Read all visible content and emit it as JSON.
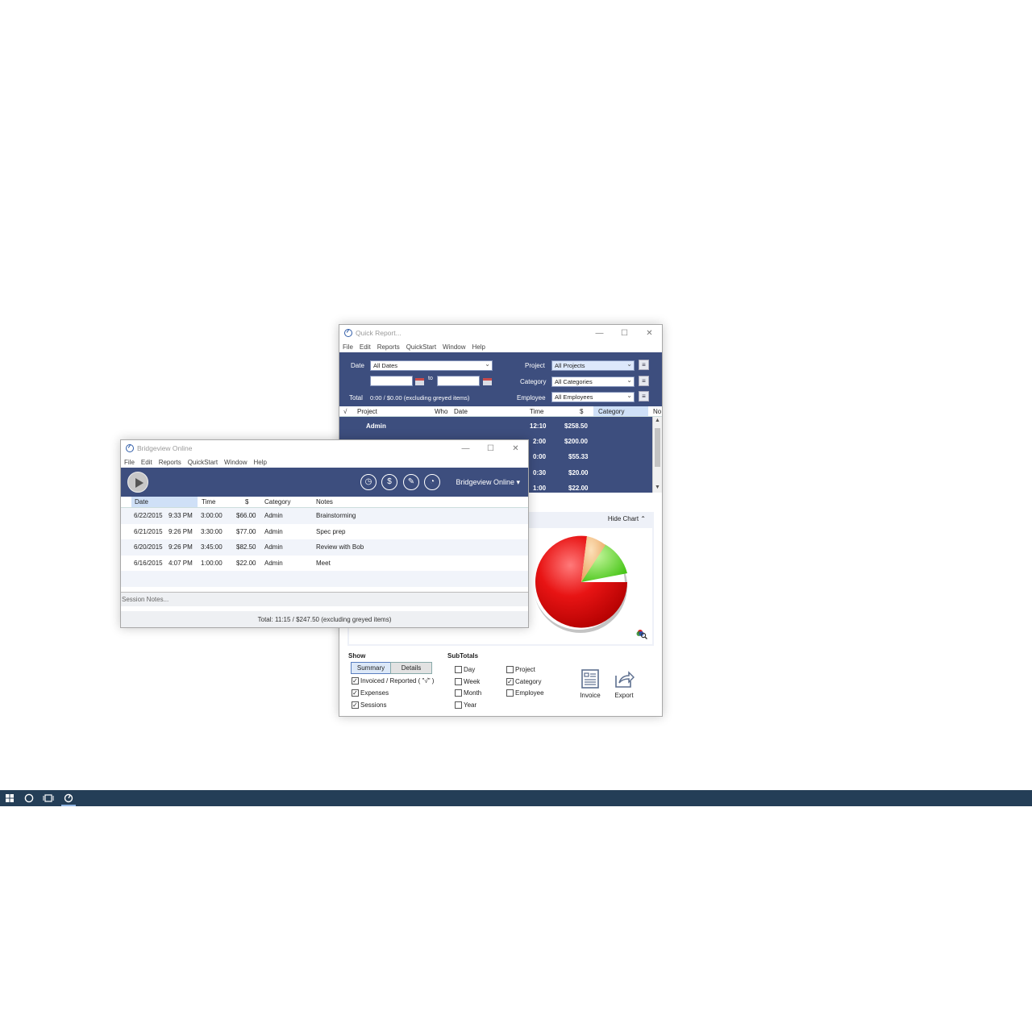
{
  "quick_report": {
    "title": "Quick Report...",
    "menu": [
      "File",
      "Edit",
      "Reports",
      "QuickStart",
      "Window",
      "Help"
    ],
    "date_label": "Date",
    "date_value": "All Dates",
    "to_label": "to",
    "project_label": "Project",
    "project_value": "All Projects",
    "category_label": "Category",
    "category_value": "All Categories",
    "employee_label": "Employee",
    "employee_value": "All Employees",
    "total_label": "Total",
    "total_value": "0:00 / $0.00 (excluding greyed items)",
    "columns": {
      "check": "√",
      "project": "Project",
      "who": "Who",
      "date": "Date",
      "time": "Time",
      "dollar": "$",
      "category": "Category",
      "notes": "No"
    },
    "rows": [
      {
        "project": "Admin",
        "time": "12:10",
        "amount": "$258.50"
      },
      {
        "project": "",
        "time": "2:00",
        "amount": "$200.00"
      },
      {
        "project": "",
        "time": "0:00",
        "amount": "$55.33"
      },
      {
        "project": "",
        "time": "0:30",
        "amount": "$20.00"
      },
      {
        "project": "",
        "time": "1:00",
        "amount": "$22.00"
      }
    ],
    "hide_chart": "Hide Chart",
    "show_label": "Show",
    "summary_btn": "Summary",
    "details_btn": "Details",
    "show_options": [
      {
        "label": "Invoiced / Reported ( \"√\" )",
        "checked": true
      },
      {
        "label": "Expenses",
        "checked": true
      },
      {
        "label": "Sessions",
        "checked": true
      }
    ],
    "subtotals_label": "SubTotals",
    "subtotals_col1": [
      {
        "label": "Day",
        "checked": false
      },
      {
        "label": "Week",
        "checked": false
      },
      {
        "label": "Month",
        "checked": false
      },
      {
        "label": "Year",
        "checked": false
      }
    ],
    "subtotals_col2": [
      {
        "label": "Project",
        "checked": false
      },
      {
        "label": "Category",
        "checked": true
      },
      {
        "label": "Employee",
        "checked": false
      }
    ],
    "invoice_btn": "Invoice",
    "export_btn": "Export",
    "pie_colors": [
      "#e01010",
      "#5fd11f",
      "#f0b070"
    ]
  },
  "bridgeview": {
    "title": "Bridgeview Online",
    "menu": [
      "File",
      "Edit",
      "Reports",
      "QuickStart",
      "Window",
      "Help"
    ],
    "account": "Bridgeview Online ▾",
    "columns": {
      "date": "Date",
      "time": "Time",
      "dollar": "$",
      "category": "Category",
      "notes": "Notes"
    },
    "rows": [
      {
        "date": "6/22/2015",
        "clock": "9:33 PM",
        "time": "3:00:00",
        "amount": "$66.00",
        "category": "Admin",
        "notes": "Brainstorming"
      },
      {
        "date": "6/21/2015",
        "clock": "9:26 PM",
        "time": "3:30:00",
        "amount": "$77.00",
        "category": "Admin",
        "notes": "Spec prep"
      },
      {
        "date": "6/20/2015",
        "clock": "9:26 PM",
        "time": "3:45:00",
        "amount": "$82.50",
        "category": "Admin",
        "notes": "Review with Bob"
      },
      {
        "date": "6/16/2015",
        "clock": "4:07 PM",
        "time": "1:00:00",
        "amount": "$22.00",
        "category": "Admin",
        "notes": "Meet"
      }
    ],
    "session_notes": "Session Notes...",
    "status": "Total: 11:15 / $247.50 (excluding greyed items)"
  }
}
